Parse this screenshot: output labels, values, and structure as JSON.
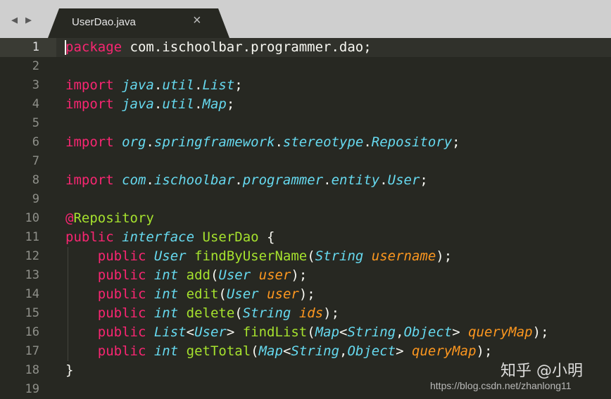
{
  "tabbar": {
    "nav_left": "◀",
    "nav_right": "▶",
    "tab_title": "UserDao.java",
    "tab_close": "×"
  },
  "editor": {
    "active_line": 1,
    "lines": [
      {
        "no": "1",
        "tokens": [
          {
            "t": "package",
            "c": "kw"
          },
          {
            "t": " com.ischoolbar.programmer.dao;",
            "c": "tx"
          }
        ]
      },
      {
        "no": "2",
        "tokens": []
      },
      {
        "no": "3",
        "tokens": [
          {
            "t": "import",
            "c": "kw"
          },
          {
            "t": " ",
            "c": "tx"
          },
          {
            "t": "java",
            "c": "st"
          },
          {
            "t": ".",
            "c": "tx"
          },
          {
            "t": "util",
            "c": "st"
          },
          {
            "t": ".",
            "c": "tx"
          },
          {
            "t": "List",
            "c": "st"
          },
          {
            "t": ";",
            "c": "tx"
          }
        ]
      },
      {
        "no": "4",
        "tokens": [
          {
            "t": "import",
            "c": "kw"
          },
          {
            "t": " ",
            "c": "tx"
          },
          {
            "t": "java",
            "c": "st"
          },
          {
            "t": ".",
            "c": "tx"
          },
          {
            "t": "util",
            "c": "st"
          },
          {
            "t": ".",
            "c": "tx"
          },
          {
            "t": "Map",
            "c": "st"
          },
          {
            "t": ";",
            "c": "tx"
          }
        ]
      },
      {
        "no": "5",
        "tokens": []
      },
      {
        "no": "6",
        "tokens": [
          {
            "t": "import",
            "c": "kw"
          },
          {
            "t": " ",
            "c": "tx"
          },
          {
            "t": "org",
            "c": "st"
          },
          {
            "t": ".",
            "c": "tx"
          },
          {
            "t": "springframework",
            "c": "st"
          },
          {
            "t": ".",
            "c": "tx"
          },
          {
            "t": "stereotype",
            "c": "st"
          },
          {
            "t": ".",
            "c": "tx"
          },
          {
            "t": "Repository",
            "c": "st"
          },
          {
            "t": ";",
            "c": "tx"
          }
        ]
      },
      {
        "no": "7",
        "tokens": []
      },
      {
        "no": "8",
        "tokens": [
          {
            "t": "import",
            "c": "kw"
          },
          {
            "t": " ",
            "c": "tx"
          },
          {
            "t": "com",
            "c": "st"
          },
          {
            "t": ".",
            "c": "tx"
          },
          {
            "t": "ischoolbar",
            "c": "st"
          },
          {
            "t": ".",
            "c": "tx"
          },
          {
            "t": "programmer",
            "c": "st"
          },
          {
            "t": ".",
            "c": "tx"
          },
          {
            "t": "entity",
            "c": "st"
          },
          {
            "t": ".",
            "c": "tx"
          },
          {
            "t": "User",
            "c": "st"
          },
          {
            "t": ";",
            "c": "tx"
          }
        ]
      },
      {
        "no": "9",
        "tokens": []
      },
      {
        "no": "10",
        "tokens": [
          {
            "t": "@",
            "c": "kw"
          },
          {
            "t": "Repository",
            "c": "fn"
          }
        ]
      },
      {
        "no": "11",
        "tokens": [
          {
            "t": "public",
            "c": "kw"
          },
          {
            "t": " ",
            "c": "tx"
          },
          {
            "t": "interface",
            "c": "st"
          },
          {
            "t": " ",
            "c": "tx"
          },
          {
            "t": "UserDao",
            "c": "fn"
          },
          {
            "t": " {",
            "c": "tx"
          }
        ]
      },
      {
        "no": "12",
        "tokens": [
          {
            "t": "    ",
            "c": "tx"
          },
          {
            "t": "public",
            "c": "kw"
          },
          {
            "t": " ",
            "c": "tx"
          },
          {
            "t": "User",
            "c": "st"
          },
          {
            "t": " ",
            "c": "tx"
          },
          {
            "t": "findByUserName",
            "c": "fn"
          },
          {
            "t": "(",
            "c": "tx"
          },
          {
            "t": "String",
            "c": "st"
          },
          {
            "t": " ",
            "c": "tx"
          },
          {
            "t": "username",
            "c": "pa"
          },
          {
            "t": ");",
            "c": "tx"
          }
        ]
      },
      {
        "no": "13",
        "tokens": [
          {
            "t": "    ",
            "c": "tx"
          },
          {
            "t": "public",
            "c": "kw"
          },
          {
            "t": " ",
            "c": "tx"
          },
          {
            "t": "int",
            "c": "st"
          },
          {
            "t": " ",
            "c": "tx"
          },
          {
            "t": "add",
            "c": "fn"
          },
          {
            "t": "(",
            "c": "tx"
          },
          {
            "t": "User",
            "c": "st"
          },
          {
            "t": " ",
            "c": "tx"
          },
          {
            "t": "user",
            "c": "pa"
          },
          {
            "t": ");",
            "c": "tx"
          }
        ]
      },
      {
        "no": "14",
        "tokens": [
          {
            "t": "    ",
            "c": "tx"
          },
          {
            "t": "public",
            "c": "kw"
          },
          {
            "t": " ",
            "c": "tx"
          },
          {
            "t": "int",
            "c": "st"
          },
          {
            "t": " ",
            "c": "tx"
          },
          {
            "t": "edit",
            "c": "fn"
          },
          {
            "t": "(",
            "c": "tx"
          },
          {
            "t": "User",
            "c": "st"
          },
          {
            "t": " ",
            "c": "tx"
          },
          {
            "t": "user",
            "c": "pa"
          },
          {
            "t": ");",
            "c": "tx"
          }
        ]
      },
      {
        "no": "15",
        "tokens": [
          {
            "t": "    ",
            "c": "tx"
          },
          {
            "t": "public",
            "c": "kw"
          },
          {
            "t": " ",
            "c": "tx"
          },
          {
            "t": "int",
            "c": "st"
          },
          {
            "t": " ",
            "c": "tx"
          },
          {
            "t": "delete",
            "c": "fn"
          },
          {
            "t": "(",
            "c": "tx"
          },
          {
            "t": "String",
            "c": "st"
          },
          {
            "t": " ",
            "c": "tx"
          },
          {
            "t": "ids",
            "c": "pa"
          },
          {
            "t": ");",
            "c": "tx"
          }
        ]
      },
      {
        "no": "16",
        "tokens": [
          {
            "t": "    ",
            "c": "tx"
          },
          {
            "t": "public",
            "c": "kw"
          },
          {
            "t": " ",
            "c": "tx"
          },
          {
            "t": "List",
            "c": "st"
          },
          {
            "t": "<",
            "c": "tx"
          },
          {
            "t": "User",
            "c": "st"
          },
          {
            "t": "> ",
            "c": "tx"
          },
          {
            "t": "findList",
            "c": "fn"
          },
          {
            "t": "(",
            "c": "tx"
          },
          {
            "t": "Map",
            "c": "st"
          },
          {
            "t": "<",
            "c": "tx"
          },
          {
            "t": "String",
            "c": "st"
          },
          {
            "t": ",",
            "c": "tx"
          },
          {
            "t": "Object",
            "c": "st"
          },
          {
            "t": "> ",
            "c": "tx"
          },
          {
            "t": "queryMap",
            "c": "pa"
          },
          {
            "t": ");",
            "c": "tx"
          }
        ]
      },
      {
        "no": "17",
        "tokens": [
          {
            "t": "    ",
            "c": "tx"
          },
          {
            "t": "public",
            "c": "kw"
          },
          {
            "t": " ",
            "c": "tx"
          },
          {
            "t": "int",
            "c": "st"
          },
          {
            "t": " ",
            "c": "tx"
          },
          {
            "t": "getTotal",
            "c": "fn"
          },
          {
            "t": "(",
            "c": "tx"
          },
          {
            "t": "Map",
            "c": "st"
          },
          {
            "t": "<",
            "c": "tx"
          },
          {
            "t": "String",
            "c": "st"
          },
          {
            "t": ",",
            "c": "tx"
          },
          {
            "t": "Object",
            "c": "st"
          },
          {
            "t": "> ",
            "c": "tx"
          },
          {
            "t": "queryMap",
            "c": "pa"
          },
          {
            "t": ");",
            "c": "tx"
          }
        ]
      },
      {
        "no": "18",
        "tokens": [
          {
            "t": "}",
            "c": "tx"
          }
        ]
      },
      {
        "no": "19",
        "tokens": []
      }
    ]
  },
  "watermark": {
    "brand": "知乎 @小明",
    "url": "https://blog.csdn.net/zhanlong11"
  },
  "colors": {
    "background": "#272822",
    "keyword": "#f92672",
    "storage_type": "#66d9ef",
    "function": "#a6e22e",
    "parameter": "#fd971f",
    "text": "#f8f8f2"
  }
}
